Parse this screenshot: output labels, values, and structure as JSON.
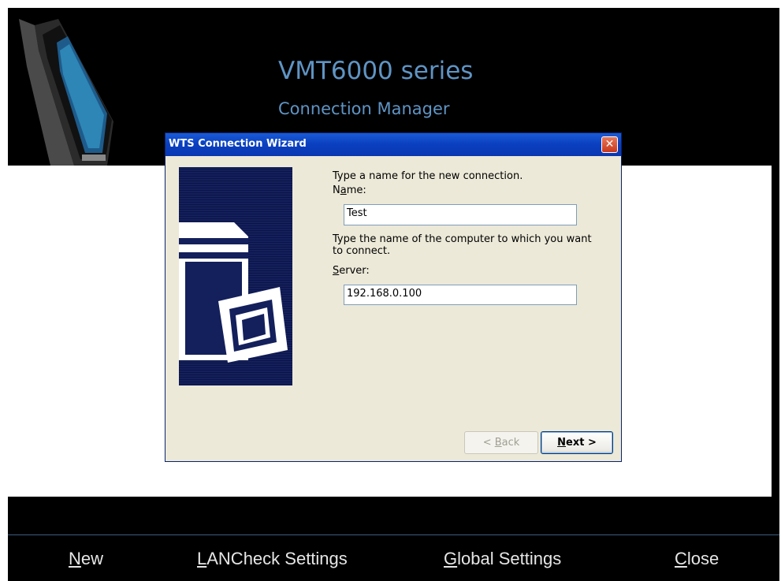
{
  "header": {
    "title": "VMT6000 series",
    "subtitle": "Connection Manager"
  },
  "dialog": {
    "title": "WTS Connection Wizard",
    "prompt_name": "Type a name for the new connection.",
    "name_label_pre": "N",
    "name_label_accel": "a",
    "name_label_post": "me:",
    "name_value": "Test",
    "prompt_server": "Type the name of the computer to which you want to connect.",
    "server_label_accel": "S",
    "server_label_post": "erver:",
    "server_value": "192.168.0.100",
    "back_pre": "< ",
    "back_accel": "B",
    "back_post": "ack",
    "next_accel": "N",
    "next_post": "ext >"
  },
  "footer": {
    "new_accel": "N",
    "new_post": "ew",
    "lancheck_accel": "L",
    "lancheck_post": "ANCheck Settings",
    "global_accel": "G",
    "global_post": "lobal Settings",
    "close_accel": "C",
    "close_post": "lose"
  },
  "colors": {
    "brand_text": "#5f94c4",
    "titlebar": "#0a3fbf",
    "dialog_bg": "#ece9d8"
  }
}
